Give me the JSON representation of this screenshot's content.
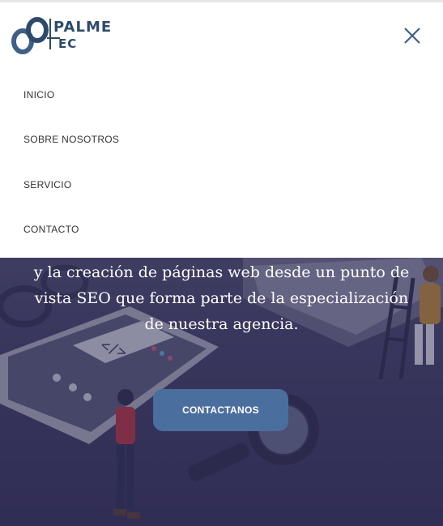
{
  "header": {
    "logo_line1": "PALME",
    "logo_line2": "EC",
    "close_icon": "close-icon"
  },
  "nav": {
    "items": [
      {
        "label": "INICIO"
      },
      {
        "label": "SOBRE NOSOTROS"
      },
      {
        "label": "SERVICIO"
      },
      {
        "label": "CONTACTO"
      }
    ]
  },
  "hero": {
    "text": "y la creación de páginas web desde un punto de vista SEO que forma parte de la especialización de nuestra agencia.",
    "button_label": "CONTACTANOS"
  },
  "colors": {
    "brand": "#2e4a6b",
    "accent": "#4a6e9e",
    "hero_bg": "#3f3d63"
  }
}
